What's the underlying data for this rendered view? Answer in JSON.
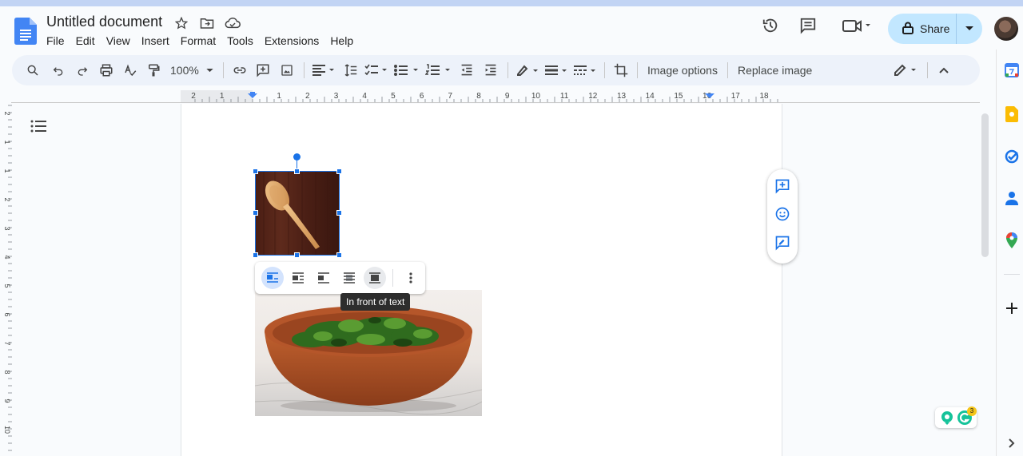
{
  "app": {
    "title": "Untitled document"
  },
  "menu": [
    "File",
    "Edit",
    "View",
    "Insert",
    "Format",
    "Tools",
    "Extensions",
    "Help"
  ],
  "header": {
    "share_label": "Share"
  },
  "toolbar": {
    "zoom": "100%",
    "image_options": "Image options",
    "replace_image": "Replace image"
  },
  "ruler": {
    "labels": [
      "2",
      "1",
      "1",
      "2",
      "3",
      "4",
      "5",
      "6",
      "7",
      "8",
      "9",
      "10",
      "11",
      "12",
      "13",
      "14",
      "15",
      "16",
      "17",
      "18"
    ]
  },
  "vruler": {
    "labels": [
      "2",
      "1",
      "1",
      "2",
      "3",
      "4",
      "5",
      "6",
      "7",
      "8",
      "9",
      "10"
    ]
  },
  "wrap_toolbar": {
    "tooltip": "In front of text"
  },
  "grammarly": {
    "count": "3"
  },
  "colors": {
    "accent": "#1a73e8",
    "share_bg": "#c2e7ff",
    "toolbar_bg": "#edf2fa"
  }
}
